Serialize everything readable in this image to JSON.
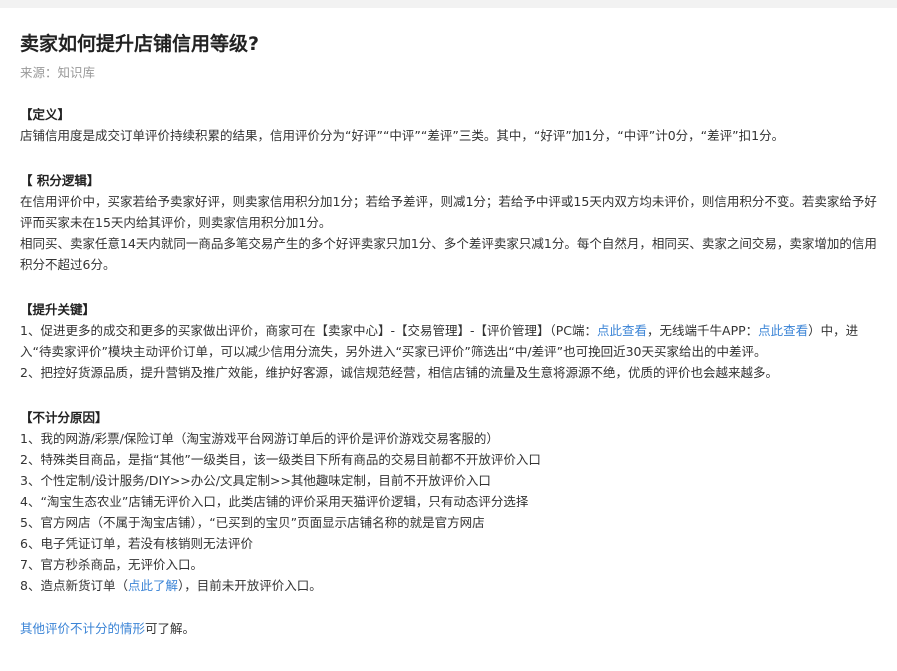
{
  "article": {
    "title": "卖家如何提升店铺信用等级?",
    "source": "来源：知识库"
  },
  "definition": {
    "heading": "【定义】",
    "text": "店铺信用度是成交订单评价持续积累的结果，信用评价分为“好评”“中评”“差评”三类。其中，“好评”加1分，“中评”计0分，“差评”扣1分。"
  },
  "scoring": {
    "heading": "【 积分逻辑】",
    "p1": "在信用评价中，买家若给予卖家好评，则卖家信用积分加1分；若给予差评，则减1分；若给予中评或15天内双方均未评价，则信用积分不变。若卖家给予好评而买家未在15天内给其评价，则卖家信用积分加1分。",
    "p2": "相同买、卖家任意14天内就同一商品多笔交易产生的多个好评卖家只加1分、多个差评卖家只减1分。每个自然月，相同买、卖家之间交易，卖家增加的信用积分不超过6分。"
  },
  "keys": {
    "heading": "【提升关键】",
    "item1_a": "1、促进更多的成交和更多的买家做出评价，商家可在【卖家中心】-【交易管理】-【评价管理】（PC端：",
    "item1_link1": "点此查看",
    "item1_b": "，无线端千牛APP：",
    "item1_link2": "点此查看",
    "item1_c": "）中，进入“待卖家评价”模块主动评价订单，可以减少信用分流失，另外进入“买家已评价”筛选出“中/差评”也可挽回近30天买家给出的中差评。",
    "item2": "2、把控好货源品质，提升营销及推广效能，维护好客源，诚信规范经营，相信店铺的流量及生意将源源不绝，优质的评价也会越来越多。"
  },
  "excluded": {
    "heading": "【不计分原因】",
    "items": [
      "1、我的网游/彩票/保险订单（淘宝游戏平台网游订单后的评价是评价游戏交易客服的）",
      "2、特殊类目商品，是指“其他”一级类目，该一级类目下所有商品的交易目前都不开放评价入口",
      "3、个性定制/设计服务/DIY>>办公/文具定制>>其他趣味定制，目前不开放评价入口",
      "4、“淘宝生态农业”店铺无评价入口，此类店铺的评价采用天猫评价逻辑，只有动态评分选择",
      "5、官方网店（不属于淘宝店铺），“已买到的宝贝”页面显示店铺名称的就是官方网店",
      "6、电子凭证订单，若没有核销则无法评价",
      "7、官方秒杀商品，无评价入口。"
    ],
    "item8_a": "8、造点新货订单（",
    "item8_link": "点此了解",
    "item8_b": "），目前未开放评价入口。"
  },
  "footer": {
    "link": "其他评价不计分的情形",
    "text": "可了解。"
  },
  "colors": {
    "link": "#3b84d6",
    "title": "#222222",
    "muted": "#999999"
  }
}
